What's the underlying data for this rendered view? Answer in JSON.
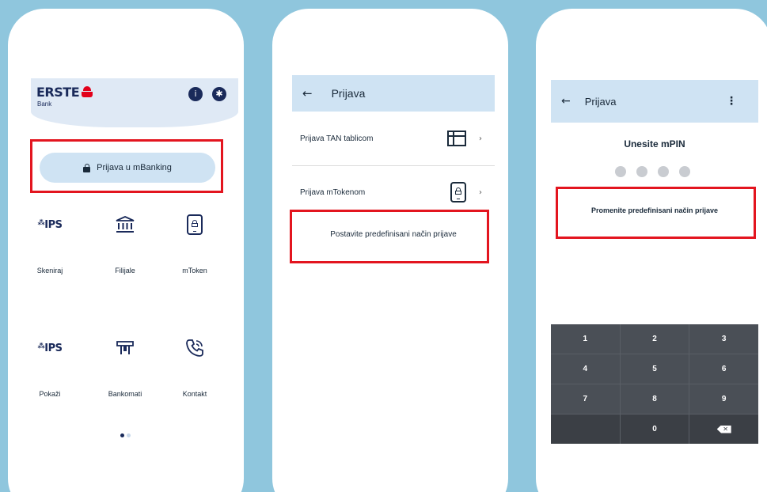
{
  "colors": {
    "background": "#8fc6dd",
    "brand_navy": "#1a2a5a",
    "brand_red": "#e2001a",
    "header_blue": "#cfe3f3",
    "highlight_red": "#e3151f",
    "keypad_gray": "#4a4f56"
  },
  "screen1": {
    "logo_text": "ERSTE",
    "logo_sub": "Bank",
    "header_icons": [
      "info-icon",
      "settings-icon"
    ],
    "login_button": "Prijava u mBanking",
    "tiles": [
      {
        "label": "Skeniraj",
        "icon": "ips-scan-icon",
        "icon_text": "IPS"
      },
      {
        "label": "Filijale",
        "icon": "bank-building-icon"
      },
      {
        "label": "mToken",
        "icon": "mtoken-icon"
      },
      {
        "label": "Pokaži",
        "icon": "ips-show-icon",
        "icon_text": "IPS"
      },
      {
        "label": "Bankomati",
        "icon": "atm-icon"
      },
      {
        "label": "Kontakt",
        "icon": "phone-call-icon"
      }
    ],
    "page_indicator": {
      "current": 1,
      "total": 2
    }
  },
  "screen2": {
    "title": "Prijava",
    "options": [
      {
        "label": "Prijava TAN tablicom",
        "icon": "tan-table-icon"
      },
      {
        "label": "Prijava mTokenom",
        "icon": "mtoken-icon"
      }
    ],
    "set_default": "Postavite predefinisani način prijave"
  },
  "screen3": {
    "title": "Prijava",
    "pin_title": "Unesite mPIN",
    "pin_length": 4,
    "change_default": "Promenite predefinisani način prijave",
    "keys": [
      "1",
      "2",
      "3",
      "4",
      "5",
      "6",
      "7",
      "8",
      "9",
      "",
      "0",
      "backspace"
    ]
  }
}
